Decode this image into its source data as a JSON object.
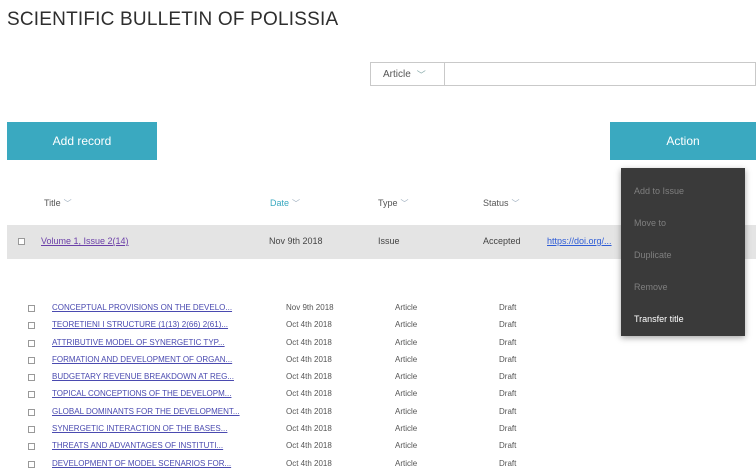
{
  "header": {
    "title": "SCIENTIFIC BULLETIN OF POLISSIA"
  },
  "search": {
    "type_value": "Article",
    "placeholder": ""
  },
  "toolbar": {
    "add_label": "Add record",
    "action_label": "Action"
  },
  "columns": {
    "title": "Title",
    "date": "Date",
    "type": "Type",
    "status": "Status"
  },
  "issue": {
    "title": "Volume 1, Issue 2(14)",
    "date": "Nov 9th 2018",
    "type": "Issue",
    "status": "Accepted",
    "link": "https://doi.org/..."
  },
  "articles": [
    {
      "title": "CONCEPTUAL PROVISIONS ON THE DEVELO...",
      "date": "Nov 9th 2018",
      "type": "Article",
      "status": "Draft"
    },
    {
      "title": "TEORETIENI I STRUCTURE (1(13) 2(66) 2(61)...",
      "date": "Oct 4th 2018",
      "type": "Article",
      "status": "Draft"
    },
    {
      "title": "ATTRIBUTIVE MODEL OF SYNERGETIC TYP...",
      "date": "Oct 4th 2018",
      "type": "Article",
      "status": "Draft"
    },
    {
      "title": "FORMATION AND DEVELOPMENT OF ORGAN...",
      "date": "Oct 4th 2018",
      "type": "Article",
      "status": "Draft"
    },
    {
      "title": "BUDGETARY REVENUE BREAKDOWN AT REG...",
      "date": "Oct 4th 2018",
      "type": "Article",
      "status": "Draft"
    },
    {
      "title": "TOPICAL CONCEPTIONS OF THE DEVELOPM...",
      "date": "Oct 4th 2018",
      "type": "Article",
      "status": "Draft"
    },
    {
      "title": "GLOBAL DOMINANTS FOR THE DEVELOPMENT...",
      "date": "Oct 4th 2018",
      "type": "Article",
      "status": "Draft"
    },
    {
      "title": "SYNERGETIC INTERACTION OF THE BASES...",
      "date": "Oct 4th 2018",
      "type": "Article",
      "status": "Draft"
    },
    {
      "title": "THREATS AND ADVANTAGES OF INSTITUTI...",
      "date": "Oct 4th 2018",
      "type": "Article",
      "status": "Draft"
    },
    {
      "title": "DEVELOPMENT OF MODEL SCENARIOS FOR...",
      "date": "Oct 4th 2018",
      "type": "Article",
      "status": "Draft"
    }
  ],
  "action_menu": {
    "items": [
      {
        "label": "Add to Issue"
      },
      {
        "label": "Move to"
      },
      {
        "label": "Duplicate"
      },
      {
        "label": "Remove"
      },
      {
        "label": "Transfer title"
      }
    ]
  },
  "icons": {
    "chevron": "chevron-down-icon",
    "sort": "sort-arrow-icon",
    "checkbox": "checkbox-icon"
  }
}
